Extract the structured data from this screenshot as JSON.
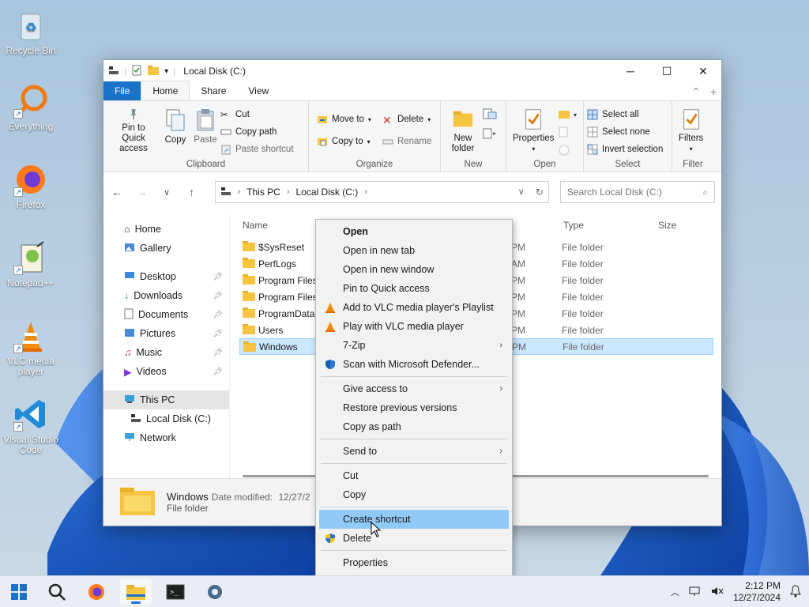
{
  "desktop": {
    "icons": [
      {
        "label": "Recycle Bin",
        "icon": "recycle-bin-icon"
      },
      {
        "label": "Everything",
        "icon": "everything-search-icon"
      },
      {
        "label": "Firefox",
        "icon": "firefox-icon"
      },
      {
        "label": "Notepad++",
        "icon": "notepad-plus-plus-icon"
      },
      {
        "label": "VLC media player",
        "icon": "vlc-icon"
      },
      {
        "label": "Visual Studio Code",
        "icon": "vscode-icon"
      }
    ]
  },
  "window": {
    "title": "Local Disk (C:)",
    "tabs": {
      "file": "File",
      "home": "Home",
      "share": "Share",
      "view": "View"
    },
    "ribbon": {
      "clipboard": {
        "label": "Clipboard",
        "pin": "Pin to Quick access",
        "copy": "Copy",
        "paste": "Paste",
        "cut": "Cut",
        "copy_path": "Copy path",
        "paste_shortcut": "Paste shortcut"
      },
      "organize": {
        "label": "Organize",
        "move_to": "Move to",
        "copy_to": "Copy to",
        "delete": "Delete",
        "rename": "Rename"
      },
      "new": {
        "label": "New",
        "new_folder": "New folder"
      },
      "open": {
        "label": "Open",
        "properties": "Properties"
      },
      "select": {
        "label": "Select",
        "select_all": "Select all",
        "select_none": "Select none",
        "invert": "Invert selection"
      },
      "filter": {
        "label": "Filter",
        "filters": "Filters"
      }
    },
    "address": {
      "segments": [
        "This PC",
        "Local Disk (C:)"
      ],
      "search_placeholder": "Search Local Disk (C:)"
    },
    "nav": {
      "home": "Home",
      "gallery": "Gallery",
      "quick": [
        {
          "label": "Desktop",
          "icon": "desktop-icon"
        },
        {
          "label": "Downloads",
          "icon": "download-icon"
        },
        {
          "label": "Documents",
          "icon": "documents-icon"
        },
        {
          "label": "Pictures",
          "icon": "pictures-icon"
        },
        {
          "label": "Music",
          "icon": "music-icon"
        },
        {
          "label": "Videos",
          "icon": "videos-icon"
        }
      ],
      "this_pc": "This PC",
      "local_disk": "Local Disk (C:)",
      "network": "Network"
    },
    "columns": {
      "name": "Name",
      "type": "Type",
      "size": "Size"
    },
    "files": [
      {
        "name": "$SysReset",
        "date_tail": "PM",
        "type": "File folder"
      },
      {
        "name": "PerfLogs",
        "date_tail": "AM",
        "type": "File folder"
      },
      {
        "name": "Program Files",
        "date_tail": "PM",
        "type": "File folder"
      },
      {
        "name": "Program Files",
        "date_tail": "PM",
        "type": "File folder"
      },
      {
        "name": "ProgramData",
        "date_tail": "PM",
        "type": "File folder"
      },
      {
        "name": "Users",
        "date_tail": "PM",
        "type": "File folder"
      },
      {
        "name": "Windows",
        "date_tail": "PM",
        "type": "File folder"
      }
    ],
    "details": {
      "name": "Windows",
      "modified_label": "Date modified:",
      "modified_value": "12/27/2",
      "kind": "File folder"
    }
  },
  "context_menu": {
    "items": [
      {
        "label": "Open",
        "bold": true
      },
      {
        "label": "Open in new tab"
      },
      {
        "label": "Open in new window"
      },
      {
        "label": "Pin to Quick access"
      },
      {
        "label": "Add to VLC media player's Playlist",
        "icon": "vlc-icon"
      },
      {
        "label": "Play with VLC media player",
        "icon": "vlc-icon"
      },
      {
        "label": "7-Zip",
        "submenu": true
      },
      {
        "label": "Scan with Microsoft Defender...",
        "icon": "defender-shield-icon"
      },
      {
        "sep": true
      },
      {
        "label": "Give access to",
        "submenu": true
      },
      {
        "label": "Restore previous versions"
      },
      {
        "label": "Copy as path"
      },
      {
        "sep": true
      },
      {
        "label": "Send to",
        "submenu": true
      },
      {
        "sep": true
      },
      {
        "label": "Cut"
      },
      {
        "label": "Copy"
      },
      {
        "sep": true
      },
      {
        "label": "Create shortcut",
        "highlighted": true
      },
      {
        "label": "Delete",
        "icon": "uac-shield-icon"
      },
      {
        "sep": true
      },
      {
        "label": "Properties"
      }
    ]
  },
  "taskbar": {
    "time": "2:12 PM",
    "date": "12/27/2024",
    "accent": "#1a73c8"
  }
}
